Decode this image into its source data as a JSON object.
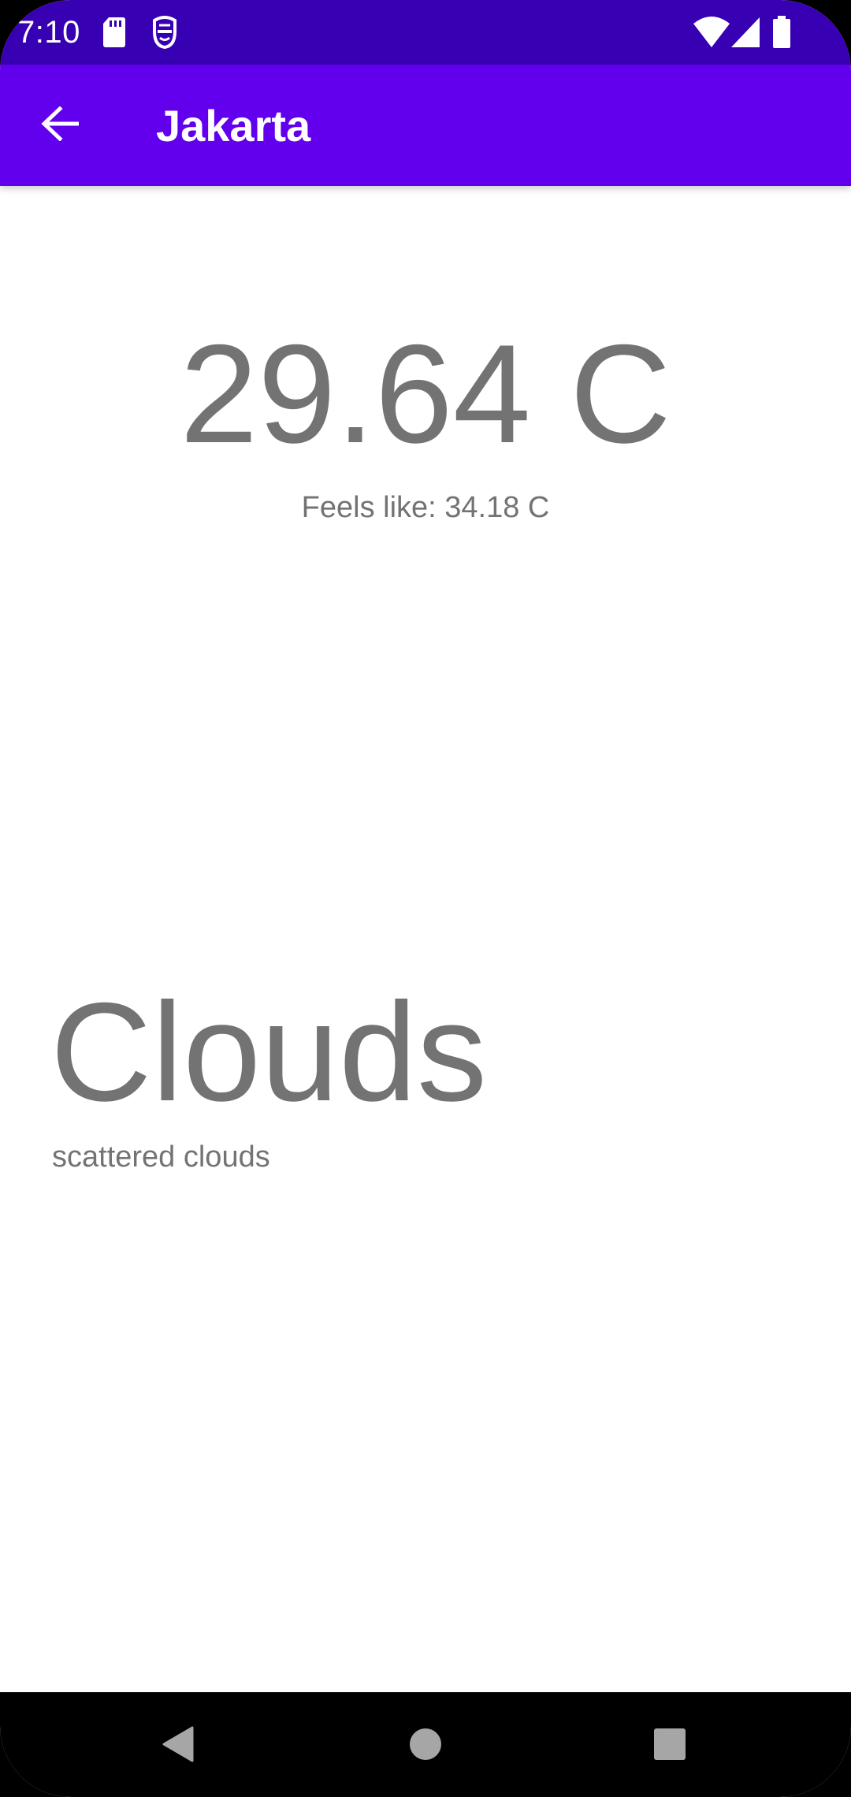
{
  "status_bar": {
    "time": "7:10",
    "icons_left": [
      "sd-card-icon",
      "notification-app-icon"
    ],
    "icons_right": [
      "wifi-icon",
      "cell-signal-icon",
      "battery-icon"
    ]
  },
  "app_bar": {
    "title": "Jakarta",
    "back_icon": "arrow-back-icon"
  },
  "weather": {
    "temperature": "29.64 C",
    "feels_like": "Feels like: 34.18 C",
    "main": "Clouds",
    "description": "scattered clouds"
  },
  "nav_bar": {
    "buttons": [
      "back-triangle-icon",
      "home-circle-icon",
      "recents-square-icon"
    ]
  },
  "colors": {
    "status_bar": "#3700b3",
    "app_bar": "#6200ee",
    "text_secondary": "#737373",
    "nav_bar": "#000000"
  }
}
